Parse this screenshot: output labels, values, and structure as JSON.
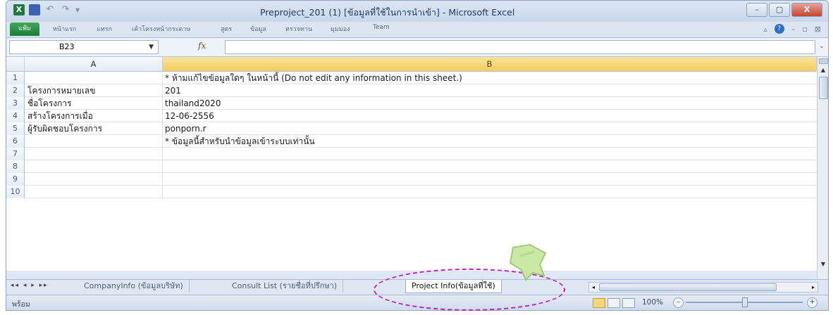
{
  "titlebar": {
    "title": "Preproject_201 (1) [ข้อมูลที่ใช้ในการนำเข้า] - Microsoft Excel",
    "min_label": "–",
    "max_label": "▢",
    "close_label": "X"
  },
  "ribbon": {
    "file_tab": "แฟ้ม",
    "tabs": [
      "หน้าแรก",
      "แทรก",
      "เค้าโครงหน้ากระดาษ",
      "สูตร",
      "ข้อมูล",
      "ตรวจทาน",
      "มุมมอง",
      "Team"
    ],
    "help_label": "?"
  },
  "formula_bar": {
    "name_box": "B23",
    "fx_label": "fx",
    "value": ""
  },
  "grid": {
    "col_a": "A",
    "col_b": "B",
    "rows": [
      {
        "num": "1",
        "a": "",
        "b": "* ห้ามแก้ไขข้อมูลใดๆ ในหน้านี้ (Do not edit any information in this sheet.)"
      },
      {
        "num": "2",
        "a": "โครงการหมายเลข",
        "b": "201"
      },
      {
        "num": "3",
        "a": "ชื่อโครงการ",
        "b": "thailand2020"
      },
      {
        "num": "4",
        "a": "สร้างโครงการเมื่อ",
        "b": "12-06-2556"
      },
      {
        "num": "5",
        "a": "ผู้รับผิดชอบโครงการ",
        "b": "ponporn.r"
      },
      {
        "num": "6",
        "a": "",
        "b": "* ข้อมูลนี้สำหรับนำข้อมูลเข้าระบบเท่านั้น"
      },
      {
        "num": "7",
        "a": "",
        "b": ""
      },
      {
        "num": "8",
        "a": "",
        "b": ""
      },
      {
        "num": "9",
        "a": "",
        "b": ""
      },
      {
        "num": "10",
        "a": "",
        "b": ""
      }
    ]
  },
  "sheet_tabs": {
    "nav": "◂◂ ◂ ▸ ▸▸",
    "tabs": [
      "CompanyInfo (ข้อมูลบริษัท)",
      "Consult List (รายชื่อที่ปรึกษา)",
      "Project Info(ข้อมูลที่ใช้)"
    ],
    "active_index": 2
  },
  "statusbar": {
    "ready": "พร้อม",
    "zoom": "100%",
    "zoom_minus": "–",
    "zoom_plus": "+"
  },
  "colors": {
    "annotation": "#c01cc8",
    "selected_column": "#f4cc5e",
    "file_tab": "#1e7b39"
  },
  "icons": [
    "excel-icon",
    "save-icon",
    "undo-icon",
    "redo-icon",
    "help-icon",
    "cursor-icon"
  ]
}
